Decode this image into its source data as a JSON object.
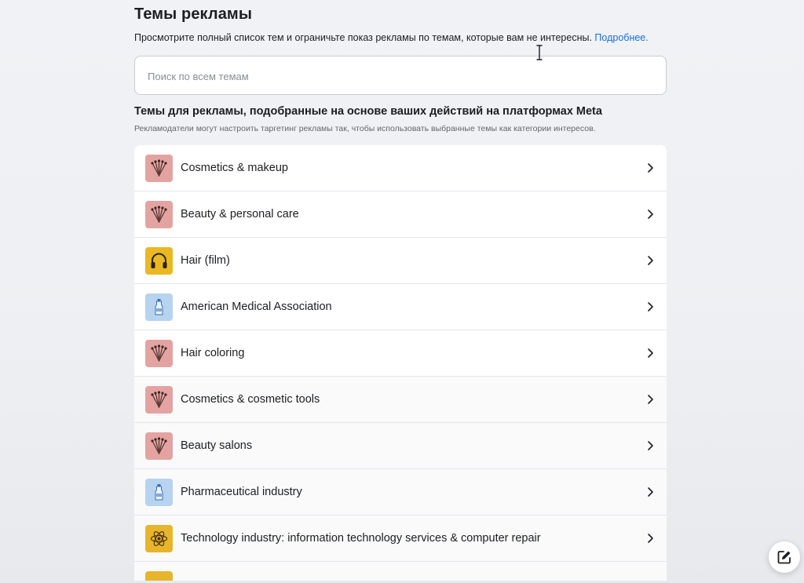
{
  "header": {
    "title": "Темы рекламы",
    "description": "Просмотрите полный список тем и ограничьте показ рекламы по темам, которые вам не интересны.",
    "learn_more": "Подробнее."
  },
  "search": {
    "placeholder": "Поиск по всем темам"
  },
  "section": {
    "title": "Темы для рекламы, подобранные на основе ваших действий на платформах Meta",
    "subtitle": "Рекламодатели могут настроить таргетинг рекламы так, чтобы использовать выбранные темы как категории интересов."
  },
  "topics": [
    {
      "label": "Cosmetics & makeup",
      "icon": "makeup-brushes-icon"
    },
    {
      "label": "Beauty & personal care",
      "icon": "makeup-brushes-icon"
    },
    {
      "label": "Hair (film)",
      "icon": "headphones-icon"
    },
    {
      "label": "American Medical Association",
      "icon": "medicine-bottle-icon"
    },
    {
      "label": "Hair coloring",
      "icon": "makeup-brushes-icon"
    },
    {
      "label": "Cosmetics & cosmetic tools",
      "icon": "makeup-brushes-icon"
    },
    {
      "label": "Beauty salons",
      "icon": "makeup-brushes-icon"
    },
    {
      "label": "Pharmaceutical industry",
      "icon": "medicine-bottle-icon"
    },
    {
      "label": "Technology industry: information technology services & computer repair",
      "icon": "atom-icon"
    }
  ],
  "colors": {
    "link": "#1a6ed8",
    "makeup_tile": "#e3a4a1",
    "headphones_tile": "#e9b824",
    "medicine_tile": "#b6d3f0",
    "atom_tile": "#e7b52c"
  },
  "fab_icon": "compose-icon"
}
